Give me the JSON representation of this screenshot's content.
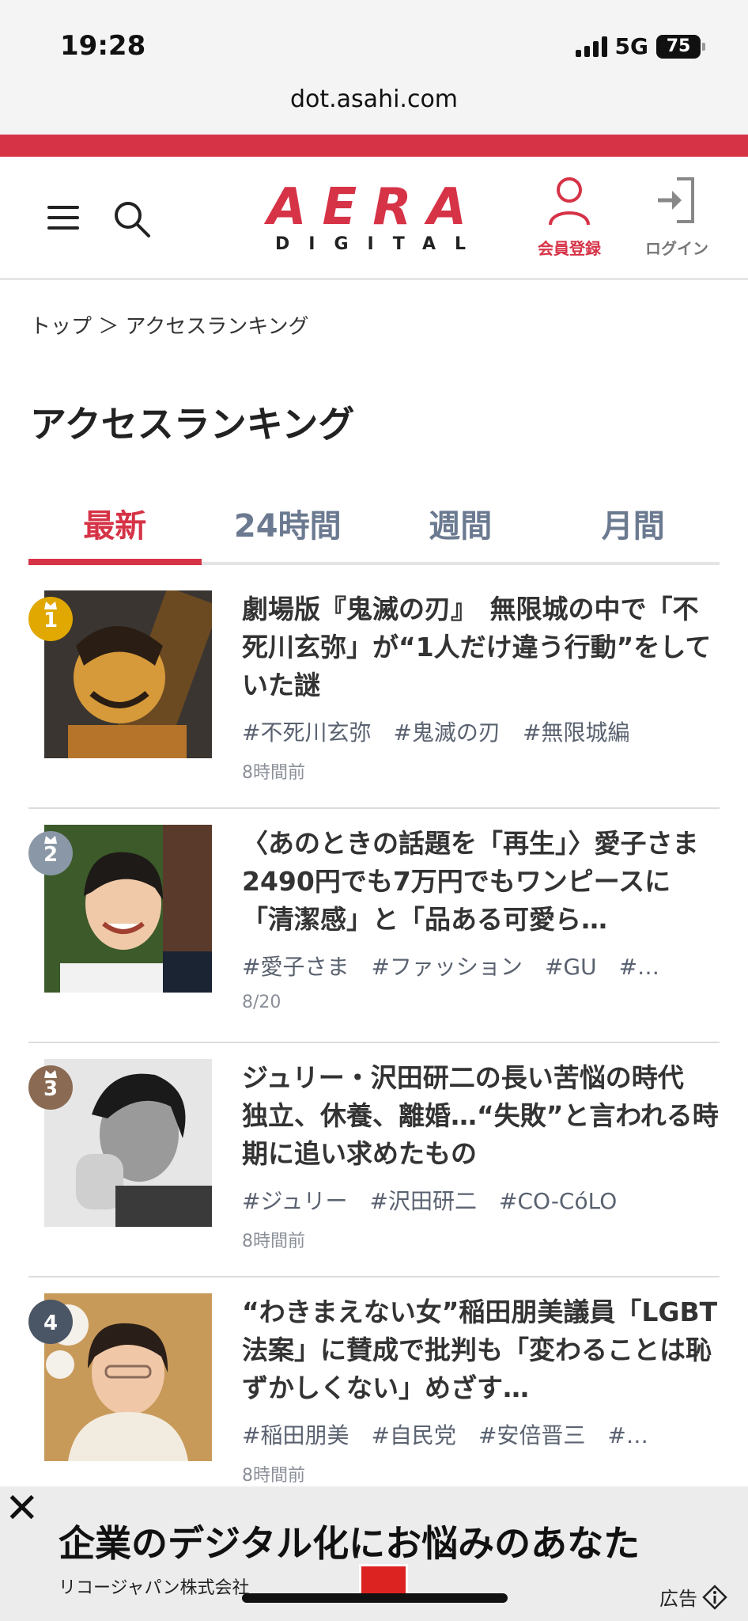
{
  "status": {
    "time": "19:28",
    "network": "5G",
    "battery": "75"
  },
  "url": "dot.asahi.com",
  "header": {
    "logo_main": "AERA",
    "logo_sub": "DIGITAL",
    "member_label": "会員登録",
    "login_label": "ログイン"
  },
  "breadcrumb": "トップ ＞ アクセスランキング",
  "page_title": "アクセスランキング",
  "tabs": [
    {
      "label": "最新"
    },
    {
      "label": "24時間"
    },
    {
      "label": "週間"
    },
    {
      "label": "月間"
    }
  ],
  "articles": [
    {
      "rank": "1",
      "headline": "劇場版『鬼滅の刃』　無限城の中で「不死川玄弥」が“1人だけ違う行動”をしていた謎",
      "tags": [
        "#不死川玄弥",
        "#鬼滅の刃",
        "#無限城編"
      ],
      "date": "8時間前"
    },
    {
      "rank": "2",
      "headline": "〈あのときの話題を「再生」〉愛子さま　2490円でも7万円でもワンピースに「清潔感」と「品ある可愛ら…",
      "tags": [
        "#愛子さま",
        "#ファッション",
        "#GU",
        "#…"
      ],
      "date": "8/20"
    },
    {
      "rank": "3",
      "headline": "ジュリー・沢田研二の長い苦悩の時代　独立、休養、離婚…“失敗”と言われる時期に追い求めたもの",
      "tags": [
        "#ジュリー",
        "#沢田研二",
        "#CO-CóLO"
      ],
      "date": "8時間前"
    },
    {
      "rank": "4",
      "headline": "“わきまえない女”稲田朋美議員「LGBT法案」に賛成で批判も「変わることは恥ずかしくない」めざす…",
      "tags": [
        "#稲田朋美",
        "#自民党",
        "#安倍晋三",
        "#…"
      ],
      "date": "8時間前"
    }
  ],
  "ad": {
    "close": "✕",
    "text": "企業のデジタル化にお悩みのあなた",
    "company": "リコージャパン株式会社",
    "label": "広告"
  },
  "colors": {
    "accent": "#d63347",
    "rank1": "#e0a800",
    "rank2": "#8a97a6",
    "rank3": "#8a6a52",
    "rank4": "#4a5566"
  }
}
